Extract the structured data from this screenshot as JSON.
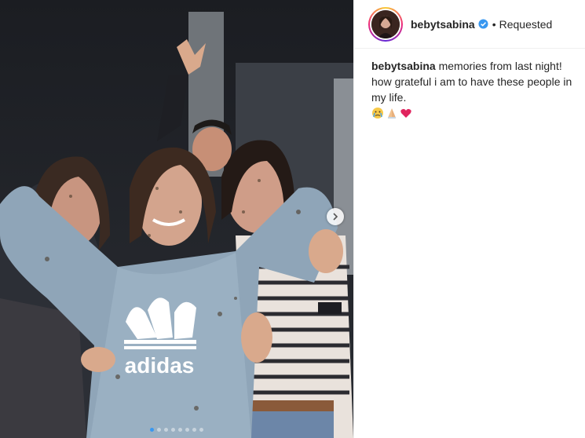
{
  "post": {
    "username": "bebytsabina",
    "verified": true,
    "separator": "•",
    "follow_status": "Requested",
    "caption_user": "bebytsabina",
    "caption_text": "memories from last night! how grateful i am to have these people in my life.",
    "emojis": [
      "crying-face-emoji",
      "folded-hands-emoji",
      "heart-emoji"
    ],
    "photo_text": "adidas",
    "carousel": {
      "total": 8,
      "current": 1
    }
  },
  "colors": {
    "link_blue": "#3897f0",
    "text": "#262626",
    "border": "#efefef"
  }
}
